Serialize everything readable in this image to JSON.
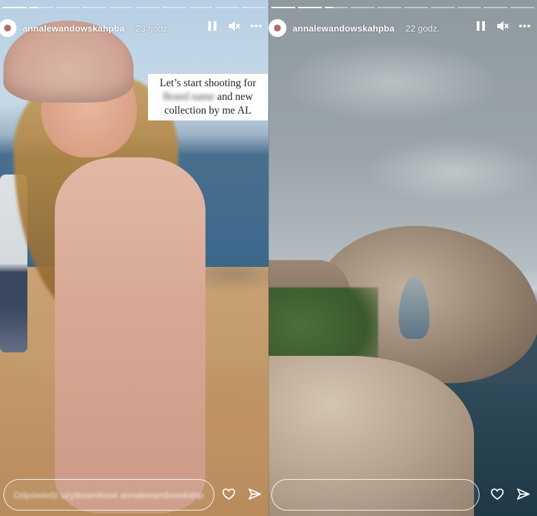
{
  "stories": [
    {
      "username": "annalewandowskahpba",
      "time": "23 godz.",
      "caption_line1": "Let’s start shooting for",
      "caption_blurred": "Brand name",
      "caption_line2": "and new",
      "caption_line3": "collection by me AL",
      "reply_placeholder": "Odpowiedz użytkownikowi annalewandowskahpba...",
      "progress": [
        1,
        0.35,
        0,
        0,
        0,
        0,
        0,
        0,
        0,
        0
      ]
    },
    {
      "username": "annalewandowskahpba",
      "time": "22 godz.",
      "reply_placeholder": "",
      "progress": [
        1,
        1,
        0.35,
        0,
        0,
        0,
        0,
        0,
        0,
        0
      ]
    }
  ],
  "icons": {
    "pause": "pause-icon",
    "mute": "mute-icon",
    "more": "more-icon",
    "like": "heart-icon",
    "share": "send-icon"
  },
  "colors": {
    "overlay_text": "#ffffff",
    "caption_bg": "#ffffff"
  }
}
